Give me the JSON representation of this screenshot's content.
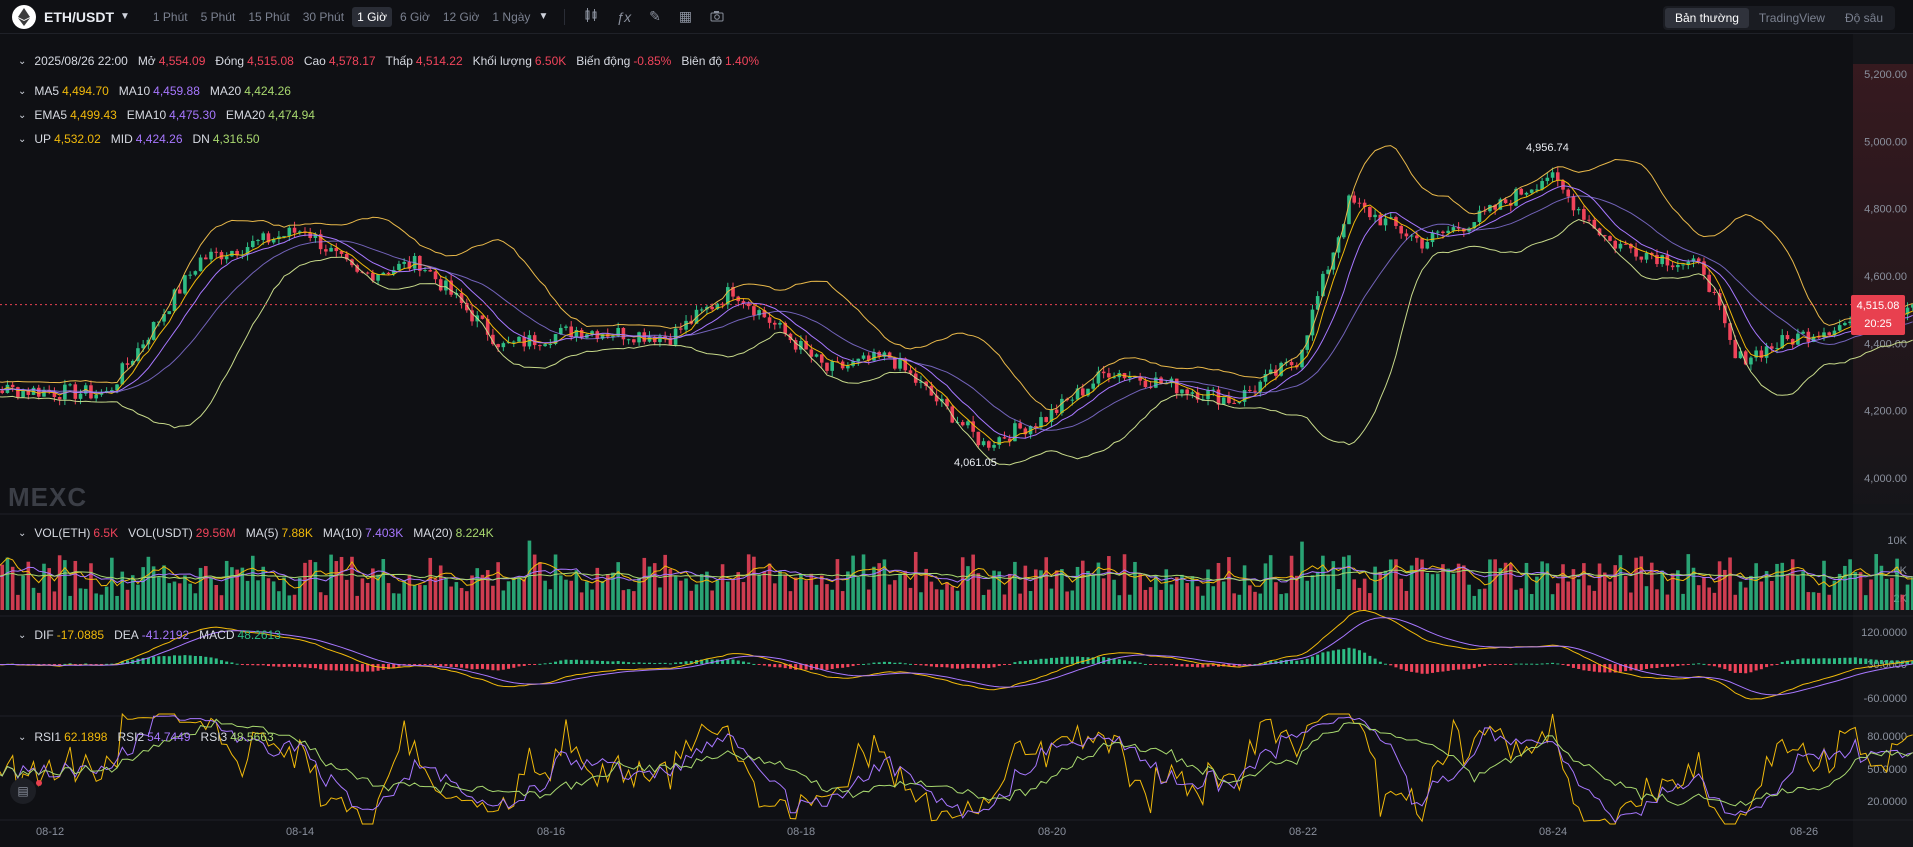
{
  "header": {
    "pair": "ETH/USDT",
    "timeframes": [
      "1 Phút",
      "5 Phút",
      "15 Phút",
      "30 Phút",
      "1 Giờ",
      "6 Giờ",
      "12 Giờ",
      "1 Ngày"
    ],
    "active_timeframe": "1 Giờ",
    "views": [
      "Bản thường",
      "TradingView",
      "Độ sâu"
    ],
    "active_view": "Bản thường",
    "tool_icons": [
      "candles-icon",
      "indicator-fx-icon",
      "pencil-icon",
      "layout-grid-icon",
      "camera-icon"
    ]
  },
  "ohlc": {
    "datetime": "2025/08/26 22:00",
    "open_label": "Mở",
    "open": "4,554.09",
    "close_label": "Đóng",
    "close": "4,515.08",
    "high_label": "Cao",
    "high": "4,578.17",
    "low_label": "Thấp",
    "low": "4,514.22",
    "volume_label": "Khối lượng",
    "volume": "6.50K",
    "change_label": "Biến động",
    "change": "-0.85%",
    "amplitude_label": "Biên độ",
    "amplitude": "1.40%"
  },
  "ma": {
    "ma5_label": "MA5",
    "ma5": "4,494.70",
    "ma10_label": "MA10",
    "ma10": "4,459.88",
    "ma20_label": "MA20",
    "ma20": "4,424.26"
  },
  "ema": {
    "ema5_label": "EMA5",
    "ema5": "4,499.43",
    "ema10_label": "EMA10",
    "ema10": "4,475.30",
    "ema20_label": "EMA20",
    "ema20": "4,474.94"
  },
  "boll": {
    "up_label": "UP",
    "up": "4,532.02",
    "mid_label": "MID",
    "mid": "4,424.26",
    "dn_label": "DN",
    "dn": "4,316.50"
  },
  "volume": {
    "eth_label": "VOL(ETH)",
    "eth": "6.5K",
    "usdt_label": "VOL(USDT)",
    "usdt": "29.56M",
    "ma5_label": "MA(5)",
    "ma5": "7.88K",
    "ma10_label": "MA(10)",
    "ma10": "7.403K",
    "ma20_label": "MA(20)",
    "ma20": "8.224K",
    "ticks": [
      "10K",
      "6K",
      "2K"
    ]
  },
  "macd": {
    "dif_label": "DIF",
    "dif": "-17.0885",
    "dea_label": "DEA",
    "dea": "-41.2192",
    "macd_label": "MACD",
    "macd": "48.2613",
    "ticks": [
      "120.0000",
      "30.0000",
      "-60.0000"
    ]
  },
  "rsi": {
    "rsi1_label": "RSI1",
    "rsi1": "62.1898",
    "rsi2_label": "RSI2",
    "rsi2": "54.7449",
    "rsi3_label": "RSI3",
    "rsi3": "48.5663",
    "ticks": [
      "80.0000",
      "50.0000",
      "20.0000"
    ]
  },
  "price_axis": [
    "5,200.00",
    "5,000.00",
    "4,800.00",
    "4,600.00",
    "4,400.00",
    "4,200.00",
    "4,000.00"
  ],
  "last_price": {
    "price": "4,515.08",
    "countdown": "20:25"
  },
  "annotations": {
    "high": "4,956.74",
    "low": "4,061.05"
  },
  "watermark": "MEXC",
  "x_axis": [
    "08-12",
    "08-14",
    "08-16",
    "08-18",
    "08-20",
    "08-22",
    "08-24",
    "08-26"
  ],
  "colors": {
    "up": "#2ebd85",
    "down": "#f0445b",
    "ma5": "#f0b90b",
    "ma10": "#a777ff",
    "ma20": "#a8d86f",
    "background": "#0f1014"
  },
  "chart_data": {
    "type": "candlestick",
    "x_range": [
      "08-12",
      "08-26"
    ],
    "price_range": [
      4000,
      5200
    ],
    "anchor_prices": [
      [
        "08-11 06:00",
        4270
      ],
      [
        "08-12 12:00",
        4250
      ],
      [
        "08-13 06:00",
        4650
      ],
      [
        "08-14 02:00",
        4740
      ],
      [
        "08-14 12:00",
        4600
      ],
      [
        "08-15 00:00",
        4640
      ],
      [
        "08-15 16:00",
        4390
      ],
      [
        "08-16 06:00",
        4440
      ],
      [
        "08-17 00:00",
        4420
      ],
      [
        "08-17 12:00",
        4560
      ],
      [
        "08-18 06:00",
        4320
      ],
      [
        "08-18 18:00",
        4360
      ],
      [
        "08-19 12:00",
        4100
      ],
      [
        "08-20 00:00",
        4180
      ],
      [
        "08-20 12:00",
        4320
      ],
      [
        "08-21 12:00",
        4230
      ],
      [
        "08-22 00:00",
        4350
      ],
      [
        "08-22 10:00",
        4820
      ],
      [
        "08-23 00:00",
        4700
      ],
      [
        "08-23 12:00",
        4780
      ],
      [
        "08-24 00:00",
        4900
      ],
      [
        "08-24 12:00",
        4700
      ],
      [
        "08-25 06:00",
        4620
      ],
      [
        "08-25 12:00",
        4350
      ],
      [
        "08-26 00:00",
        4420
      ],
      [
        "08-26 22:00",
        4515
      ]
    ]
  }
}
